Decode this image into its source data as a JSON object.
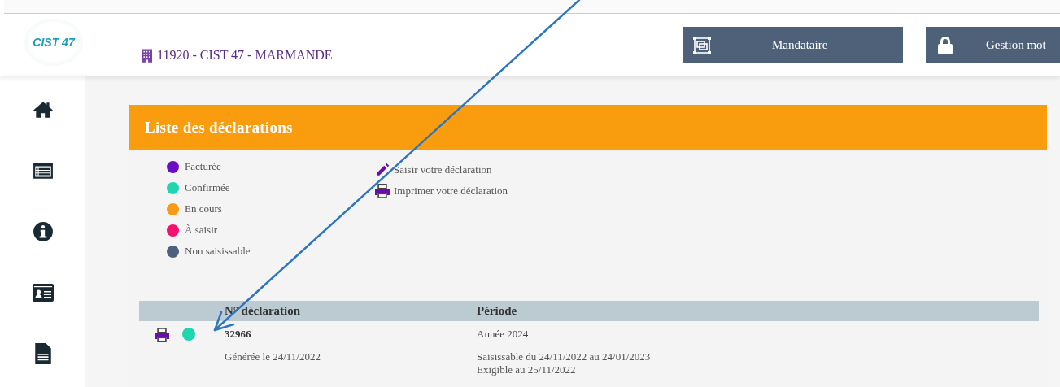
{
  "header": {
    "logo": {
      "text": "CIST 47"
    },
    "company": "11920 - CIST 47 - MARMANDE",
    "buttons": [
      {
        "kind": "mandate",
        "label": "Mandataire"
      },
      {
        "kind": "lock",
        "label": "Gestion mot"
      }
    ]
  },
  "sidebar": {
    "items": [
      {
        "kind": "home"
      },
      {
        "kind": "list"
      },
      {
        "kind": "info"
      },
      {
        "kind": "card"
      },
      {
        "kind": "document"
      }
    ]
  },
  "panel": {
    "title": "Liste des déclarations",
    "legend": [
      {
        "label": "Facturée",
        "color": "#6a0dc8"
      },
      {
        "label": "Confirmée",
        "color": "#1ed6b0"
      },
      {
        "label": "En cours",
        "color": "#f99a12"
      },
      {
        "label": "À saisir",
        "color": "#f2126e"
      },
      {
        "label": "Non saisissable",
        "color": "#4f5f7e"
      }
    ],
    "actions": [
      {
        "kind": "edit",
        "label": "Saisir votre déclaration"
      },
      {
        "kind": "print",
        "label": "Imprimer votre déclaration"
      }
    ],
    "table": {
      "columns": [
        "N° déclaration",
        "Période"
      ],
      "rows": [
        {
          "color": "#1ed6b0",
          "number": "32966",
          "generated": "Générée le 24/11/2022",
          "period": "Année 2024",
          "period_details": [
            "Saisissable du 24/11/2022 au 24/01/2023",
            "Exigible au 25/11/2022"
          ]
        }
      ]
    }
  },
  "annotation": {
    "kind": "arrow"
  }
}
